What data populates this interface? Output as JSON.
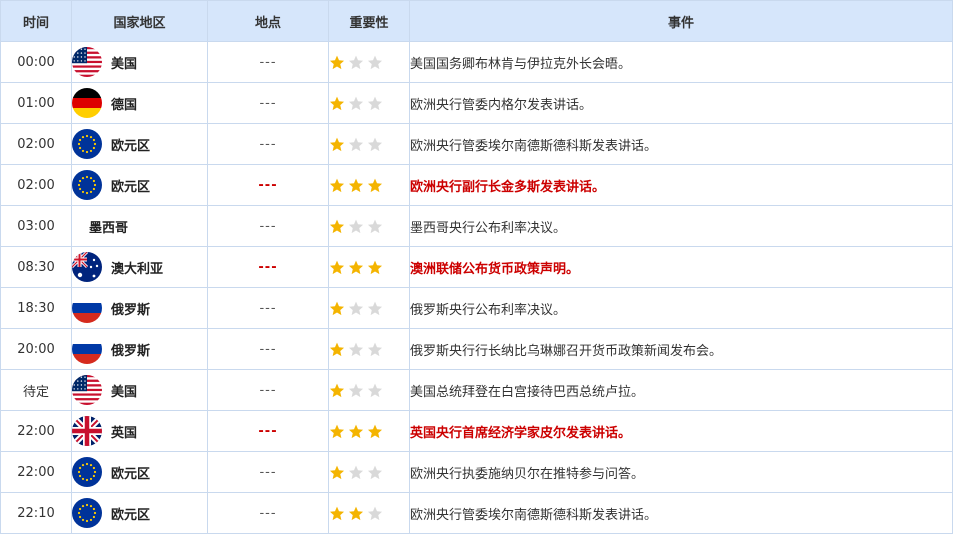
{
  "headers": {
    "time": "时间",
    "region": "国家地区",
    "location": "地点",
    "importance": "重要性",
    "event": "事件"
  },
  "colors": {
    "header_bg": "#d6e6fb",
    "border": "#c9d9ee",
    "star_on": "#f4b400",
    "star_off": "#d9d9d9",
    "high_text": "#cc0000"
  },
  "rows": [
    {
      "time": "00:00",
      "flag": "us-flag-icon",
      "region": "美国",
      "location": "---",
      "stars": 1,
      "event": "美国国务卿布林肯与伊拉克外长会晤。",
      "high": false
    },
    {
      "time": "01:00",
      "flag": "de-flag-icon",
      "region": "德国",
      "location": "---",
      "stars": 1,
      "event": "欧洲央行管委内格尔发表讲话。",
      "high": false
    },
    {
      "time": "02:00",
      "flag": "eu-flag-icon",
      "region": "欧元区",
      "location": "---",
      "stars": 1,
      "event": "欧洲央行管委埃尔南德斯德科斯发表讲话。",
      "high": false
    },
    {
      "time": "02:00",
      "flag": "eu-flag-icon",
      "region": "欧元区",
      "location": "---",
      "stars": 3,
      "event": "欧洲央行副行长金多斯发表讲话。",
      "high": true
    },
    {
      "time": "03:00",
      "flag": "",
      "region": "墨西哥",
      "location": "---",
      "stars": 1,
      "event": "墨西哥央行公布利率决议。",
      "high": false
    },
    {
      "time": "08:30",
      "flag": "au-flag-icon",
      "region": "澳大利亚",
      "location": "---",
      "stars": 3,
      "event": "澳洲联储公布货币政策声明。",
      "high": true
    },
    {
      "time": "18:30",
      "flag": "ru-flag-icon",
      "region": "俄罗斯",
      "location": "---",
      "stars": 1,
      "event": "俄罗斯央行公布利率决议。",
      "high": false
    },
    {
      "time": "20:00",
      "flag": "ru-flag-icon",
      "region": "俄罗斯",
      "location": "---",
      "stars": 1,
      "event": "俄罗斯央行行长纳比乌琳娜召开货币政策新闻发布会。",
      "high": false
    },
    {
      "time": "待定",
      "flag": "us-flag-icon",
      "region": "美国",
      "location": "---",
      "stars": 1,
      "event": "美国总统拜登在白宫接待巴西总统卢拉。",
      "high": false
    },
    {
      "time": "22:00",
      "flag": "uk-flag-icon",
      "region": "英国",
      "location": "---",
      "stars": 3,
      "event": "英国央行首席经济学家皮尔发表讲话。",
      "high": true
    },
    {
      "time": "22:00",
      "flag": "eu-flag-icon",
      "region": "欧元区",
      "location": "---",
      "stars": 1,
      "event": "欧洲央行执委施纳贝尔在推特参与问答。",
      "high": false
    },
    {
      "time": "22:10",
      "flag": "eu-flag-icon",
      "region": "欧元区",
      "location": "---",
      "stars": 2,
      "event": "欧洲央行管委埃尔南德斯德科斯发表讲话。",
      "high": false
    }
  ]
}
